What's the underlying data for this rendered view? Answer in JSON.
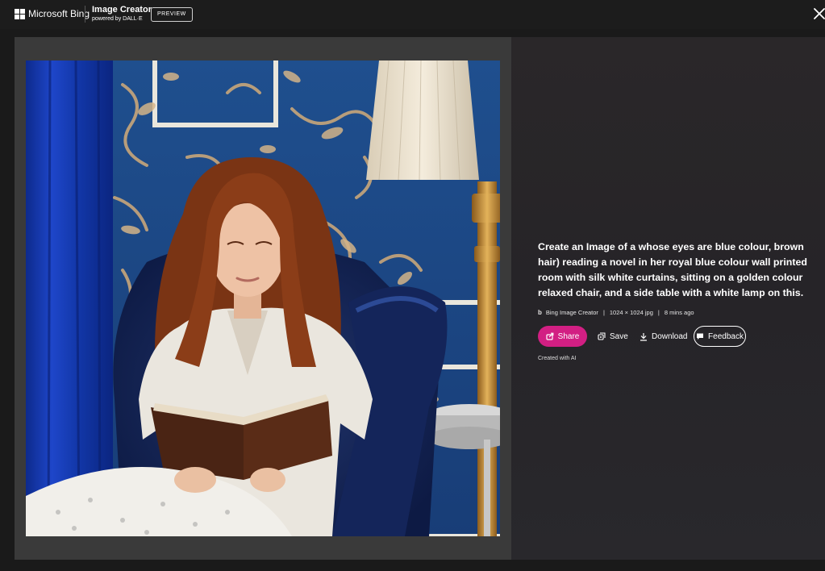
{
  "header": {
    "brand": "Microsoft Bing",
    "product_title": "Image Creator",
    "product_subtitle": "powered by DALL·E",
    "preview_badge": "PREVIEW"
  },
  "image": {
    "alt": "Woman with long auburn hair reading a brown book while seated in a royal blue velvet armchair against blue wallpaper with gold floral pattern, blue curtain at left, and a cream lampshade on a brass floor lamp at right"
  },
  "details": {
    "prompt": "Create an Image of a whose eyes are blue colour, brown hair) reading a novel in her royal blue colour wall printed room with silk white curtains, sitting on a golden colour relaxed chair, and a side table with a white lamp on this.",
    "source_icon": "b",
    "source": "Bing Image Creator",
    "dimensions": "1024 × 1024 jpg",
    "age": "8 mins ago",
    "separator": "|",
    "created_with": "Created with AI"
  },
  "actions": {
    "share_label": "Share",
    "save_label": "Save",
    "download_label": "Download",
    "feedback_label": "Feedback"
  },
  "colors": {
    "share_bg": "#d21f83",
    "background": "#1a1a1a",
    "panel": "#3a3a3a"
  },
  "icons": [
    "microsoft-logo-icon",
    "close-icon",
    "share-icon",
    "save-icon",
    "download-icon",
    "feedback-icon"
  ]
}
